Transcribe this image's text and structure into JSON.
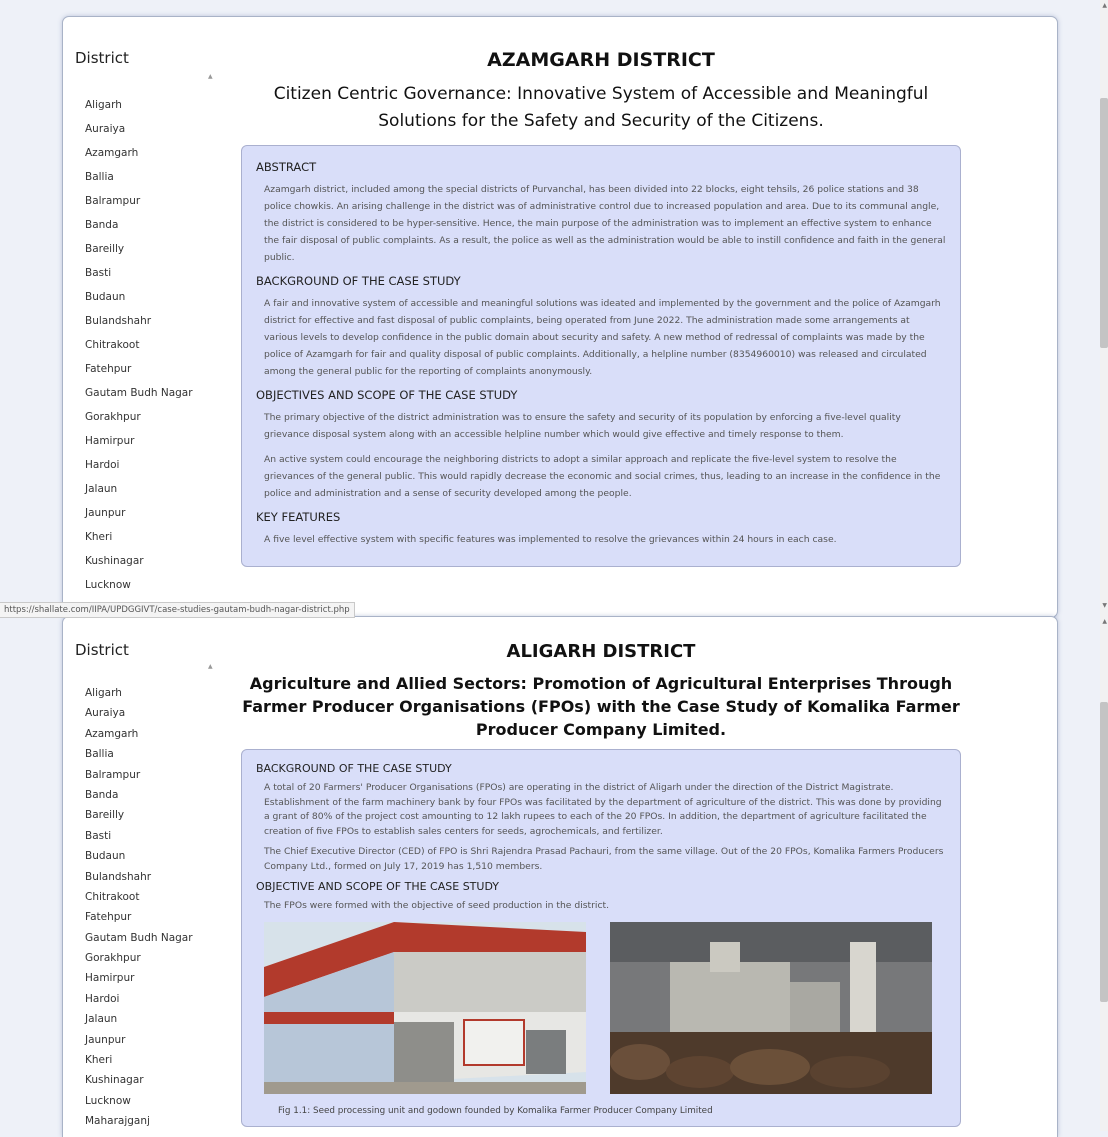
{
  "sidebar": {
    "title": "District",
    "items_top": [
      "Aligarh",
      "Auraiya",
      "Azamgarh",
      "Ballia",
      "Balrampur",
      "Banda",
      "Bareilly",
      "Basti",
      "Budaun",
      "Bulandshahr",
      "Chitrakoot",
      "Fatehpur",
      "Gautam Budh Nagar",
      "Gorakhpur",
      "Hamirpur",
      "Hardoi",
      "Jalaun",
      "Jaunpur",
      "Kheri",
      "Kushinagar",
      "Lucknow"
    ],
    "items_bottom": [
      "Aligarh",
      "Auraiya",
      "Azamgarh",
      "Ballia",
      "Balrampur",
      "Banda",
      "Bareilly",
      "Basti",
      "Budaun",
      "Bulandshahr",
      "Chitrakoot",
      "Fatehpur",
      "Gautam Budh Nagar",
      "Gorakhpur",
      "Hamirpur",
      "Hardoi",
      "Jalaun",
      "Jaunpur",
      "Kheri",
      "Kushinagar",
      "Lucknow",
      "Maharajganj"
    ]
  },
  "panel1": {
    "district_title": "AZAMGARH DISTRICT",
    "case_title": "Citizen Centric Governance: Innovative System of Accessible and Meaningful Solutions for the Safety and Security of the Citizens.",
    "sections": [
      {
        "heading": "ABSTRACT",
        "paras": [
          "Azamgarh district, included among the special districts of Purvanchal, has been divided into 22 blocks, eight tehsils, 26 police stations and 38 police chowkis. An arising challenge in the district was of administrative control due to increased population and area. Due to its communal angle, the district is considered to be hyper-sensitive. Hence, the main purpose of the administration was to implement an effective system to enhance the fair disposal of public complaints. As a result, the police as well as the administration would be able to instill confidence and faith in the general public."
        ]
      },
      {
        "heading": "BACKGROUND OF THE CASE STUDY",
        "paras": [
          "A fair and innovative system of accessible and meaningful solutions was ideated and implemented by the government and the police of Azamgarh district for effective and fast disposal of public complaints, being operated from June 2022. The administration made some arrangements at various levels to develop confidence in the public domain about security and safety. A new method of redressal of complaints was made by the police of Azamgarh for fair and quality disposal of public complaints. Additionally, a helpline number (8354960010) was released and circulated among the general public for the reporting of complaints anonymously."
        ]
      },
      {
        "heading": "OBJECTIVES AND SCOPE OF THE CASE STUDY",
        "paras": [
          "The primary objective of the district administration was to ensure the safety and security of its population by enforcing a five-level quality grievance disposal system along with an accessible helpline number which would give effective and timely response to them.",
          "An active system could encourage the neighboring districts to adopt a similar approach and replicate the five-level system to resolve the grievances of the general public. This would rapidly decrease the economic and social crimes, thus, leading to an increase in the confidence in the police and administration and a sense of security developed among the people."
        ]
      },
      {
        "heading": "KEY FEATURES",
        "paras": [
          "A five level effective system with specific features was implemented to resolve the grievances within 24 hours in each case."
        ]
      }
    ]
  },
  "status_url": "https://shallate.com/IIPA/UPDGGIVT/case-studies-gautam-budh-nagar-district.php",
  "panel2": {
    "district_title": "ALIGARH DISTRICT",
    "case_title": "Agriculture and Allied Sectors: Promotion of Agricultural Enterprises Through Farmer Producer Organisations (FPOs) with the Case Study of Komalika Farmer Producer Company Limited.",
    "sections": [
      {
        "heading": "BACKGROUND OF THE CASE STUDY",
        "paras": [
          "A total of 20 Farmers' Producer Organisations (FPOs) are operating in the district of Aligarh under the direction of the District Magistrate. Establishment of the farm machinery bank by four FPOs was facilitated by the department of agriculture of the district. This was done by providing a grant of 80% of the project cost amounting to 12 lakh rupees to each of the 20 FPOs. In addition, the department of agriculture facilitated the creation of five FPOs to establish sales centers for seeds, agrochemicals, and fertilizer.",
          "The Chief Executive Director (CED) of FPO is Shri Rajendra Prasad Pachauri, from the same village. Out of the 20 FPOs, Komalika Farmers Producers Company Ltd., formed on July 17, 2019 has 1,510 members."
        ]
      },
      {
        "heading": "OBJECTIVE AND SCOPE OF THE CASE STUDY",
        "paras": [
          "The FPOs were formed with the objective of seed production in the district."
        ]
      }
    ],
    "caption": "Fig 1.1: Seed processing unit and godown founded by Komalika Farmer Producer Company Limited"
  }
}
